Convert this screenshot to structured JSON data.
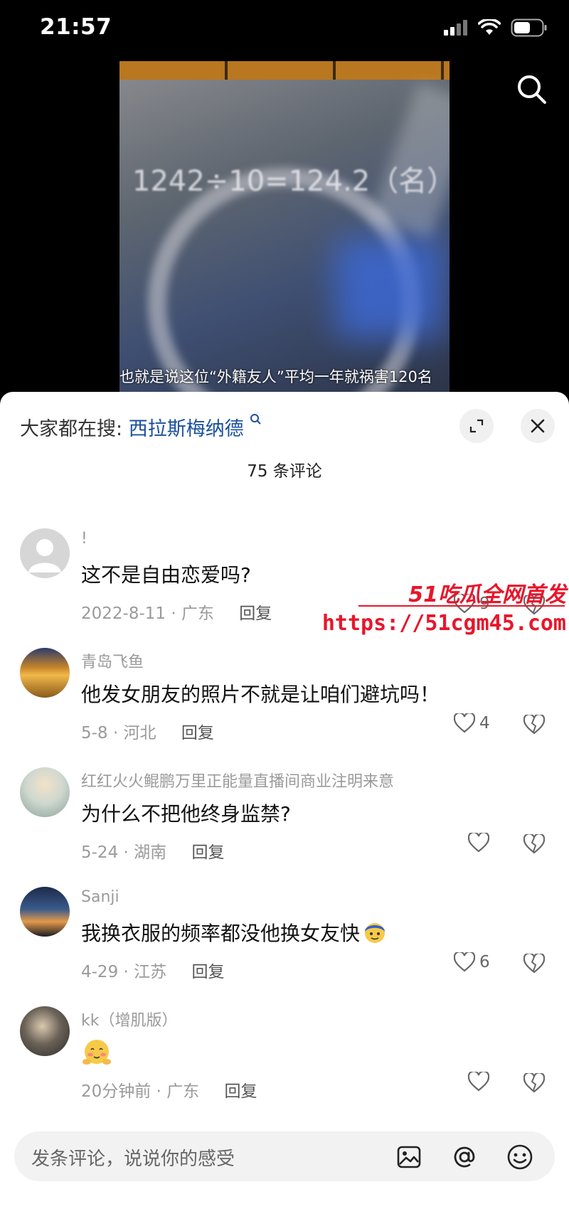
{
  "status_bar": {
    "time": "21:57"
  },
  "video": {
    "formula": "1242÷10=124.2（名）",
    "caption": "也就是说这位“外籍友人”平均一年就祸害120名"
  },
  "header": {
    "hot_search_label": "大家都在搜:",
    "hot_search_keyword": "西拉斯梅纳德",
    "comment_count": "75 条评论"
  },
  "comments": [
    {
      "user": "!",
      "text": "这不是自由恋爱吗?",
      "date": "2022-8-11 · 广东",
      "reply": "回复",
      "likes": "9"
    },
    {
      "user": "青岛飞鱼",
      "text": "他发女朋友的照片不就是让咱们避坑吗！",
      "date": "5-8 · 河北",
      "reply": "回复",
      "likes": "4"
    },
    {
      "user": "红红火火鲲鹏万里正能量直播间商业注明来意",
      "text": "为什么不把他终身监禁?",
      "date": "5-24 · 湖南",
      "reply": "回复",
      "likes": ""
    },
    {
      "user": "Sanji",
      "text": "我换衣服的频率都没他换女友快",
      "date": "4-29 · 江苏",
      "reply": "回复",
      "likes": "6"
    },
    {
      "user": "kk（增肌版）",
      "text": "",
      "date": "20分钟前 · 广东",
      "reply": "回复",
      "likes": ""
    }
  ],
  "watermark": {
    "title": "51吃瓜全网首发",
    "url": "https://51cgm45.com"
  },
  "input": {
    "placeholder": "发条评论，说说你的感受"
  },
  "icons": {
    "search": "search-icon",
    "expand": "expand-icon",
    "close": "close-icon",
    "like": "heart-icon",
    "dislike": "broken-heart-icon",
    "image": "image-icon",
    "mention": "at-icon",
    "emoji": "emoji-icon"
  },
  "colors": {
    "keyword": "#1a4f9c",
    "watermark": "#e8162b"
  }
}
